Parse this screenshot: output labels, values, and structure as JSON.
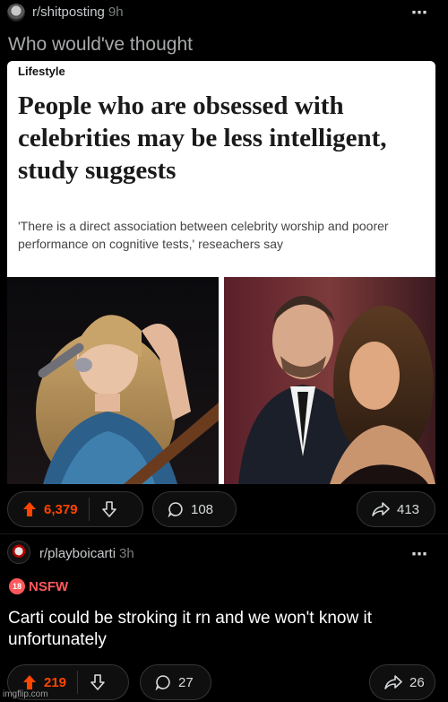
{
  "post1": {
    "subreddit": "r/shitposting",
    "time": "9h",
    "title": "Who would've thought",
    "article": {
      "kicker": "Lifestyle",
      "headline": "People who are obsessed with celebrities may be less intelligent, study suggests",
      "dek": "'There is a direct association between celebrity worship and poorer performance on cognitive tests,' reseachers say"
    },
    "upvotes": "6,379",
    "comments": "108",
    "shares": "413"
  },
  "post2": {
    "subreddit": "r/playboicarti",
    "time": "3h",
    "nsfw_badge": "18",
    "nsfw_label": "NSFW",
    "title": "Carti could be stroking it rn and we won't know it unfortunately",
    "upvotes": "219",
    "comments": "27",
    "shares": "26"
  },
  "more_icon": "⋯",
  "watermark": "imgflip.com",
  "colors": {
    "upvote": "#ff4500",
    "nsfw": "#ff585b",
    "background": "#000000"
  }
}
